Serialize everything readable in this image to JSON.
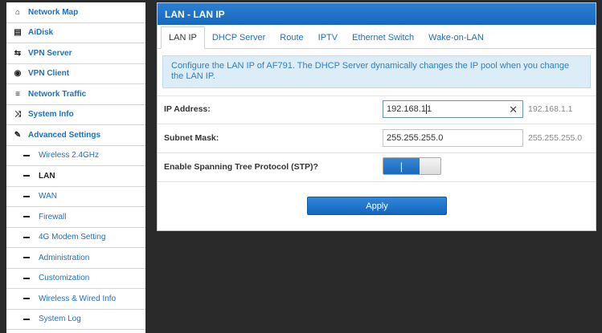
{
  "sidebar": {
    "items": [
      {
        "label": "Network Map",
        "icon": "home-icon",
        "type": "main"
      },
      {
        "label": "AiDisk",
        "icon": "disk-icon",
        "type": "main"
      },
      {
        "label": "VPN Server",
        "icon": "vpn-server-icon",
        "type": "main"
      },
      {
        "label": "VPN Client",
        "icon": "globe-icon",
        "type": "main"
      },
      {
        "label": "Network Traffic",
        "icon": "list-icon",
        "type": "main"
      },
      {
        "label": "System Info",
        "icon": "shuffle-icon",
        "type": "main"
      },
      {
        "label": "Advanced Settings",
        "icon": "wrench-icon",
        "type": "main"
      },
      {
        "label": "Wireless 2.4GHz",
        "type": "sub"
      },
      {
        "label": "LAN",
        "type": "sub",
        "active": true
      },
      {
        "label": "WAN",
        "type": "sub"
      },
      {
        "label": "Firewall",
        "type": "sub"
      },
      {
        "label": "4G Modem Setting",
        "type": "sub"
      },
      {
        "label": "Administration",
        "type": "sub"
      },
      {
        "label": "Customization",
        "type": "sub"
      },
      {
        "label": "Wireless & Wired Info",
        "type": "sub"
      },
      {
        "label": "System Log",
        "type": "sub"
      }
    ]
  },
  "panel": {
    "title": "LAN - LAN IP",
    "tabs": [
      "LAN IP",
      "DHCP Server",
      "Route",
      "IPTV",
      "Ethernet Switch",
      "Wake-on-LAN"
    ],
    "active_tab": "LAN IP",
    "info": "Configure the LAN IP of AF791. The DHCP Server dynamically changes the IP pool when you change the LAN IP.",
    "ip_label": "IP Address:",
    "ip_value_before_caret": "192.168.1",
    "ip_value_after_caret": "1",
    "ip_hint": "192.168.1.1",
    "mask_label": "Subnet Mask:",
    "mask_value": "255.255.255.0",
    "mask_hint": "255.255.255.0",
    "stp_label": "Enable Spanning Tree Protocol (STP)?",
    "stp_state": "on",
    "apply_label": "Apply"
  },
  "colors": {
    "accent": "#1e6fc0",
    "header_bg": "#1668bf",
    "info_bg": "#dcedf8",
    "page_bg": "#2a2a2a"
  }
}
